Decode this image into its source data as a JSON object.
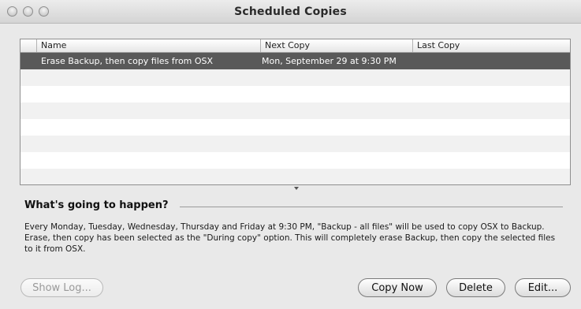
{
  "window": {
    "title": "Scheduled Copies"
  },
  "table": {
    "columns": [
      "Name",
      "Next Copy",
      "Last Copy"
    ],
    "rows": [
      {
        "name": "Erase Backup, then copy files from OSX",
        "next_copy": "Mon, September 29 at 9:30 PM",
        "last_copy": ""
      }
    ]
  },
  "info": {
    "title": "What's going to happen?",
    "description": "Every Monday, Tuesday, Wednesday, Thursday and Friday at 9:30 PM, \"Backup - all files\" will be used to copy OSX to Backup. Erase, then copy has been selected as the \"During copy\" option. This will completely erase Backup, then copy the selected files to it from OSX."
  },
  "buttons": {
    "show_log": "Show Log...",
    "copy_now": "Copy Now",
    "delete": "Delete",
    "edit": "Edit..."
  }
}
